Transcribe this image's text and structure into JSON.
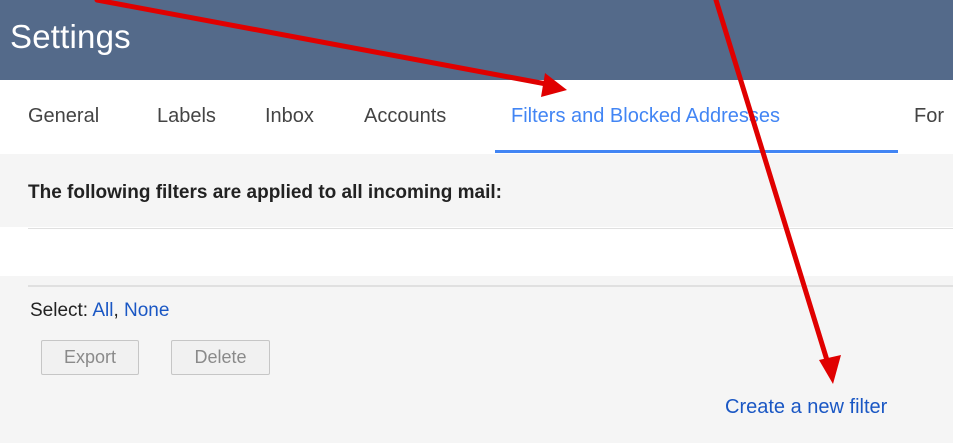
{
  "header": {
    "title": "Settings"
  },
  "tabs": [
    {
      "label": "General",
      "active": false
    },
    {
      "label": "Labels",
      "active": false
    },
    {
      "label": "Inbox",
      "active": false
    },
    {
      "label": "Accounts",
      "active": false
    },
    {
      "label": "Filters and Blocked Addresses",
      "active": true
    },
    {
      "label": "For",
      "active": false
    }
  ],
  "filters": {
    "header_text": "The following filters are applied to all incoming mail:"
  },
  "actions": {
    "select_prefix": "Select:",
    "select_all": "All",
    "separator": ",",
    "select_none": "None",
    "export_label": "Export",
    "delete_label": "Delete",
    "create_filter_label": "Create a new filter"
  },
  "colors": {
    "header_bg": "#546a8a",
    "accent": "#4285f4",
    "link": "#1a57c4",
    "annotation_arrow": "#e00000"
  }
}
